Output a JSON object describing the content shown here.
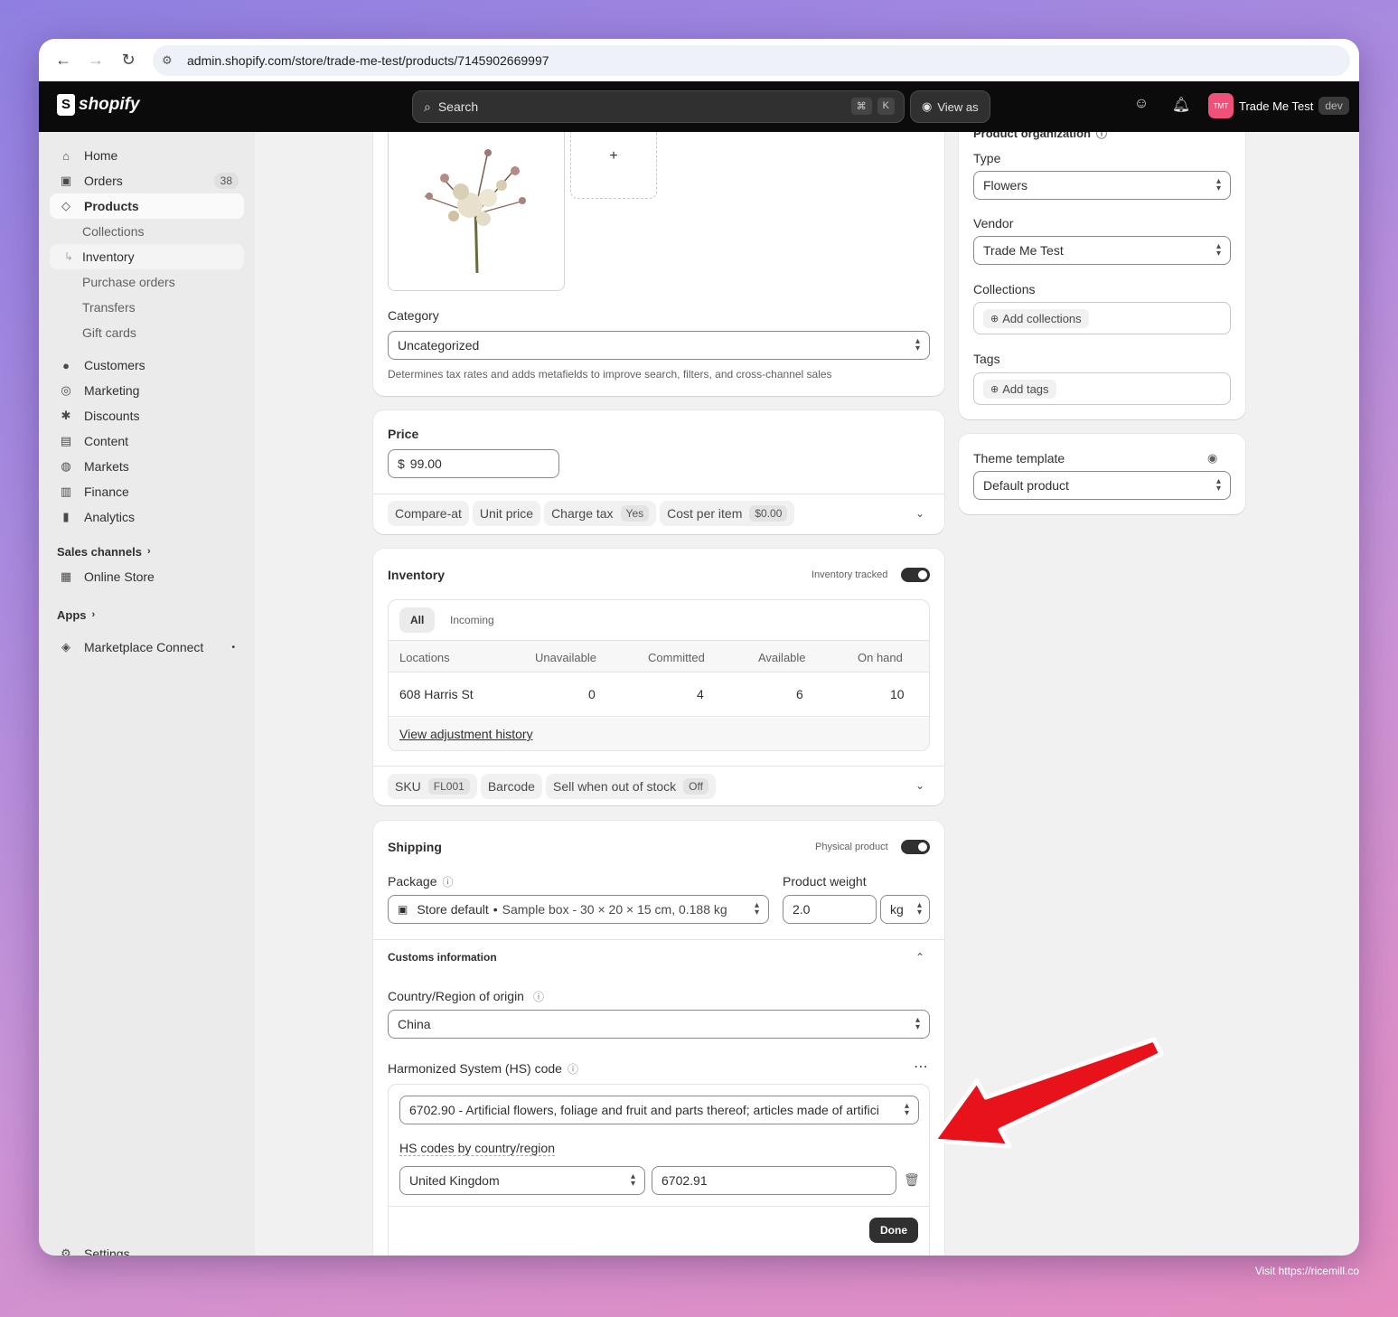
{
  "browser": {
    "url": "admin.shopify.com/store/trade-me-test/products/7145902669997"
  },
  "topbar": {
    "logo_text": "shopify",
    "search_placeholder": "Search",
    "search_kbd_1": "⌘",
    "search_kbd_2": "K",
    "view_as_label": "View as",
    "store_initials": "TMT",
    "store_name": "Trade Me Test",
    "store_badge": "dev"
  },
  "sidebar": {
    "home": "Home",
    "orders": "Orders",
    "orders_count": "38",
    "products": "Products",
    "collections": "Collections",
    "inventory": "Inventory",
    "purchase_orders": "Purchase orders",
    "transfers": "Transfers",
    "gift_cards": "Gift cards",
    "customers": "Customers",
    "marketing": "Marketing",
    "discounts": "Discounts",
    "content": "Content",
    "markets": "Markets",
    "finance": "Finance",
    "analytics": "Analytics",
    "sales_channels": "Sales channels",
    "online_store": "Online Store",
    "apps": "Apps",
    "marketplace_connect": "Marketplace Connect",
    "settings": "Settings"
  },
  "media": {
    "add_label": "+"
  },
  "category": {
    "label": "Category",
    "value": "Uncategorized",
    "help": "Determines tax rates and adds metafields to improve search, filters, and cross-channel sales"
  },
  "price": {
    "label": "Price",
    "currency": "$",
    "value": "99.00",
    "compare_at": "Compare-at",
    "unit_price": "Unit price",
    "charge_tax": "Charge tax",
    "charge_tax_value": "Yes",
    "cost_per_item": "Cost per item",
    "cost_value": "$0.00"
  },
  "inventory": {
    "title": "Inventory",
    "tracked_label": "Inventory tracked",
    "tab_all": "All",
    "tab_incoming": "Incoming",
    "headers": [
      "Locations",
      "Unavailable",
      "Committed",
      "Available",
      "On hand"
    ],
    "rows": [
      {
        "location": "608 Harris St",
        "unavailable": "0",
        "committed": "4",
        "available": "6",
        "on_hand": "10"
      }
    ],
    "history_link": "View adjustment history",
    "sku_label": "SKU",
    "sku_value": "FL001",
    "barcode": "Barcode",
    "sell_oos": "Sell when out of stock",
    "sell_oos_value": "Off"
  },
  "shipping": {
    "title": "Shipping",
    "physical_label": "Physical product",
    "package_label": "Package",
    "package_name": "Store default",
    "package_detail": "Sample box - 30 × 20 × 15 cm, 0.188 kg",
    "weight_label": "Product weight",
    "weight_value": "2.0",
    "weight_unit": "kg",
    "customs_title": "Customs information",
    "origin_label": "Country/Region of origin",
    "origin_value": "China",
    "hs_label": "Harmonized System (HS) code",
    "hs_value": "6702.90 - Artificial flowers, foliage and fruit and parts thereof; articles made of artifici",
    "hs_by_region": "HS codes by country/region",
    "region_value": "United Kingdom",
    "region_code": "6702.91",
    "done": "Done"
  },
  "organization": {
    "title": "Product organization",
    "type_label": "Type",
    "type_value": "Flowers",
    "vendor_label": "Vendor",
    "vendor_value": "Trade Me Test",
    "collections_label": "Collections",
    "collections_add": "Add collections",
    "tags_label": "Tags",
    "tags_add": "Add tags"
  },
  "theme": {
    "label": "Theme template",
    "value": "Default product"
  },
  "footer": {
    "visit": "Visit https://ricemill.co"
  },
  "colors": {
    "topbar": "#0b0b0b",
    "arrow": "#e8121b",
    "avatar": "#f0507a"
  }
}
